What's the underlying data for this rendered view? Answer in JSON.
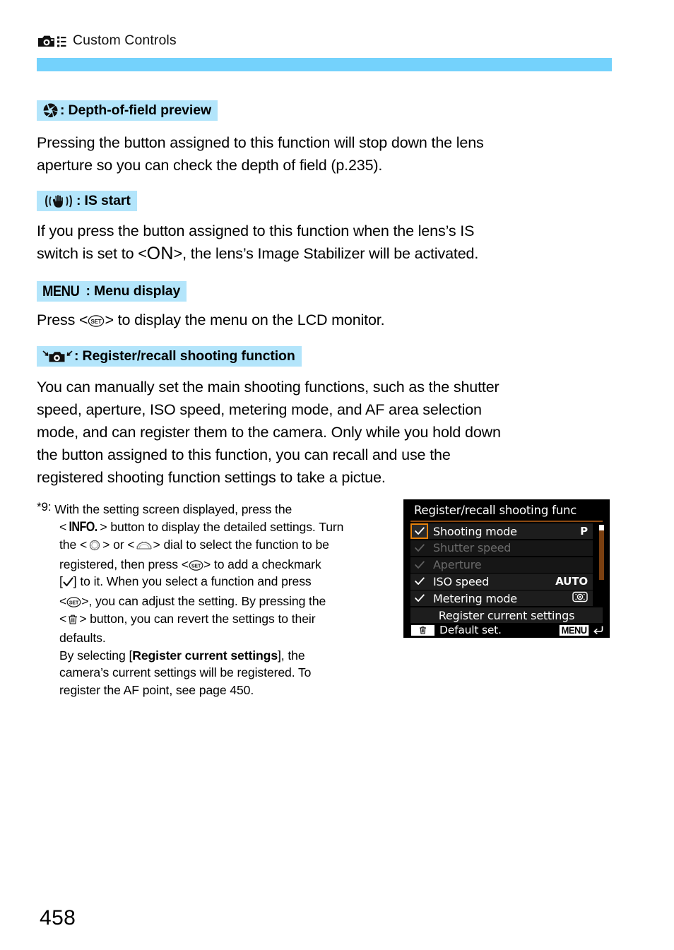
{
  "running_head": {
    "icon": "camera-menu-icon",
    "title": "Custom Controls"
  },
  "colors": {
    "rule_blue": "#74d2fc",
    "heading_highlight": "#b3e5fb",
    "lcd_background": "#000000",
    "lcd_selection_orange": "#e8820c",
    "lcd_scrollbar_brown": "#7a3f10"
  },
  "sections": [
    {
      "icon": "aperture-preview-icon",
      "colon": ":",
      "heading": "Depth-of-field preview",
      "body_line1": "Pressing the button assigned to this function will stop down the lens",
      "body_line2": "aperture so you can check the depth of field (p.235)."
    },
    {
      "icon": "image-stabilizer-icon",
      "colon": ":",
      "heading": "IS start",
      "body_line1": "If you press the button assigned to this function when the lens’s IS",
      "body_line2_a": "switch is set to <",
      "body_line2_on": "ON",
      "body_line2_b": ">, the lens’s Image Stabilizer will be activated."
    },
    {
      "icon": "menu-word-icon",
      "icon_text": "MENU",
      "colon": ":",
      "heading": "Menu display",
      "body_a": "Press <",
      "body_set_icon": "set-button-icon",
      "body_b": "> to display the menu on the LCD monitor."
    },
    {
      "icon": "register-recall-camera-icon",
      "colon": ":",
      "heading": "Register/recall shooting function",
      "body_line1": "You can manually set the main shooting functions, such as the shutter",
      "body_line2": "speed, aperture, ISO speed, metering mode, and AF area selection",
      "body_line3": "mode, and can register them to the camera. Only while you hold down",
      "body_line4": "the button assigned to this function, you can recall and use the",
      "body_line5": "registered shooting function settings to take a pictue."
    }
  ],
  "footnote": {
    "marker": "*9:",
    "seg1": "With the setting screen displayed, press the",
    "seg2_a": "<",
    "seg2_info": "INFO.",
    "seg2_b": "> button to display the detailed settings. Turn",
    "seg3_a": "the <",
    "seg3_dial1": "quick-control-dial-icon",
    "seg3_b": "> or <",
    "seg3_dial2": "main-dial-icon",
    "seg3_c": "> dial to select the function to be",
    "seg4_a": "registered, then press <",
    "seg4_set": "set-button-icon",
    "seg4_b": "> to add a checkmark",
    "seg5_a": "[",
    "seg5_check": "checkmark-icon",
    "seg5_b": "] to it. When you select a function and press",
    "seg6_a": "<",
    "seg6_set": "set-button-icon",
    "seg6_b": ">, you can adjust the setting. By pressing the",
    "seg7_a": "<",
    "seg7_trash": "trash-button-icon",
    "seg7_b": "> button, you can revert the settings to their",
    "seg8": "defaults.",
    "seg9_a": "By selecting [",
    "seg9_bold": "Register current settings",
    "seg9_b": "], the",
    "seg10": "camera’s current settings will be registered. To",
    "seg11": "register the AF point, see page 450."
  },
  "lcd": {
    "title": "Register/recall shooting func",
    "rows": [
      {
        "label": "Shooting mode",
        "value": "P",
        "checked": true,
        "selected": true,
        "disabled": false,
        "value_type": "text"
      },
      {
        "label": "Shutter speed",
        "value": "",
        "checked": true,
        "selected": false,
        "disabled": true,
        "value_type": "text"
      },
      {
        "label": "Aperture",
        "value": "",
        "checked": true,
        "selected": false,
        "disabled": true,
        "value_type": "text"
      },
      {
        "label": "ISO speed",
        "value": "AUTO",
        "checked": true,
        "selected": false,
        "disabled": false,
        "value_type": "text"
      },
      {
        "label": "Metering mode",
        "value": "evaluative-metering-icon",
        "checked": true,
        "selected": false,
        "disabled": false,
        "value_type": "icon"
      }
    ],
    "register_button": "Register current settings",
    "footer": {
      "trash_icon": "trash-icon",
      "default_label": "Default set.",
      "menu_badge": "MENU",
      "return_icon": "return-arrow-icon"
    }
  },
  "page_number": "458"
}
